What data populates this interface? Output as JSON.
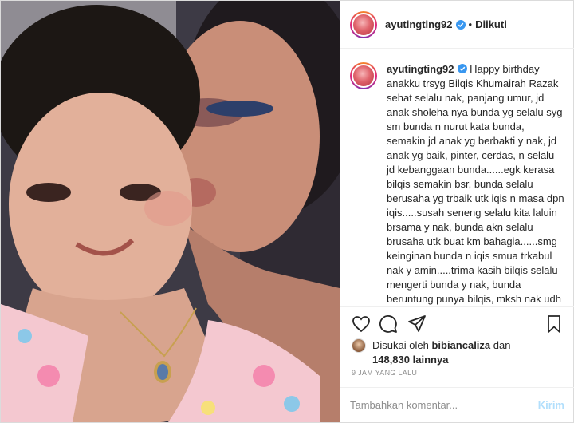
{
  "post": {
    "username": "ayutingting92",
    "follow_status": "Diikuti",
    "dot": "•",
    "verified_icon": "verified-badge-icon",
    "accent_color": "#3897f0"
  },
  "caption": {
    "username": "ayutingting92",
    "text": "Happy birthday anakku trsyg Bilqis Khumairah Razak sehat selalu nak, panjang umur, jd anak sholeha nya bunda yg selalu syg sm bunda n nurut kata bunda, semakin jd anak yg berbakti y nak, jd anak yg baik, pinter, cerdas, n selalu jd kebanggaan bunda......egk kerasa bilqis semakin bsr, bunda selalu berusaha yg trbaik utk iqis n masa dpn iqis.....susah seneng selalu kita laluin brsama y nak, bunda akn selalu brusaha utk buat km bahagia......smg keinginan bunda n iqis smua trkabul nak y amin.....trima kasih bilqis selalu mengerti bunda y nak, bunda beruntung punya bilqis, mksh nak udh hadir dlm kehidupan bunda, cinta, syg,"
  },
  "actions": {
    "icons": [
      "heart-icon",
      "comment-icon",
      "share-icon",
      "bookmark-icon"
    ]
  },
  "likes": {
    "prefix": "Disukai oleh",
    "liker": "bibiancaliza",
    "conj": "dan",
    "count": "148,830",
    "suffix": "lainnya"
  },
  "timestamp": "9 JAM YANG LALU",
  "comment": {
    "placeholder": "Tambahkan komentar...",
    "post_label": "Kirim"
  }
}
